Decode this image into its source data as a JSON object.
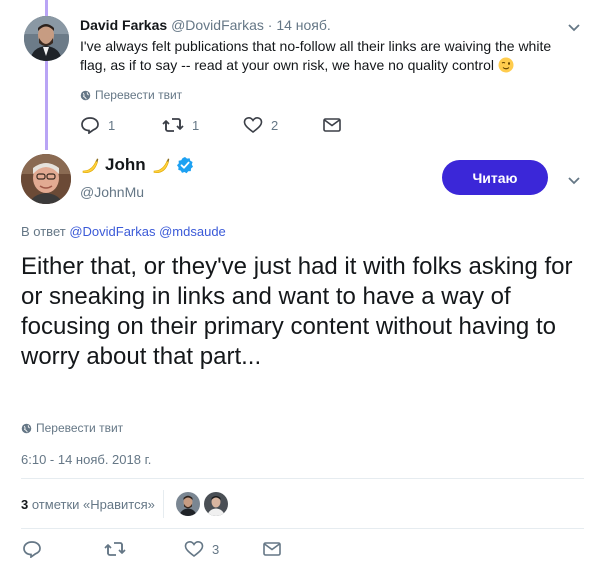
{
  "parent": {
    "name": "David Farkas",
    "handle": "@DovidFarkas",
    "dot": "·",
    "date": "14 нояб.",
    "text": "I've always felt publications that no-follow all their links are waiving the white flag, as if to say -- read at your own risk, we have no quality control",
    "translate": "Перевести твит",
    "replies": "1",
    "retweets": "1",
    "likes": "2"
  },
  "main": {
    "name": "John",
    "handle": "@JohnMu",
    "follow_label": "Читаю",
    "reply_to_prefix": "В ответ",
    "reply_to_mentions": "@DovidFarkas @mdsaude",
    "text": "Either that, or they've just had it with folks asking for or sneaking in links and want to have a way of focusing on their primary content without having to worry about that part...",
    "translate": "Перевести твит",
    "timestamp": "6:10 - 14 нояб. 2018 г.",
    "likes_count": "3",
    "likes_label": "отметки «Нравится»",
    "action_likes": "3"
  },
  "icons": {
    "reply": "reply-icon",
    "retweet": "retweet-icon",
    "like": "heart-icon",
    "dm": "envelope-icon",
    "verified": "verified-badge-icon",
    "globe": "globe-icon"
  },
  "colors": {
    "accent": "#3b27d8",
    "thread_line": "#b9a4f5",
    "verified": "#1da1f2",
    "secondary_text": "#657786"
  }
}
